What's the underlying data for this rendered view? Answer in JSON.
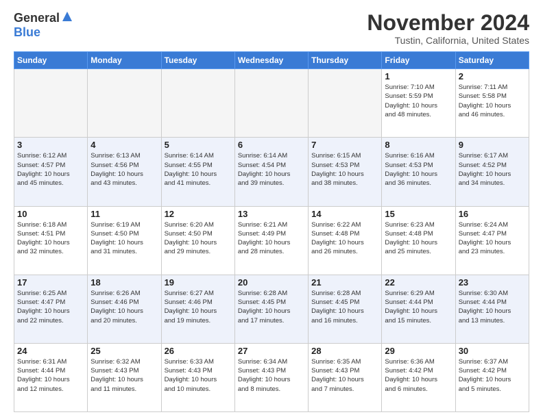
{
  "logo": {
    "general": "General",
    "blue": "Blue"
  },
  "title": "November 2024",
  "location": "Tustin, California, United States",
  "days_of_week": [
    "Sunday",
    "Monday",
    "Tuesday",
    "Wednesday",
    "Thursday",
    "Friday",
    "Saturday"
  ],
  "weeks": [
    [
      {
        "day": "",
        "info": ""
      },
      {
        "day": "",
        "info": ""
      },
      {
        "day": "",
        "info": ""
      },
      {
        "day": "",
        "info": ""
      },
      {
        "day": "",
        "info": ""
      },
      {
        "day": "1",
        "info": "Sunrise: 7:10 AM\nSunset: 5:59 PM\nDaylight: 10 hours\nand 48 minutes."
      },
      {
        "day": "2",
        "info": "Sunrise: 7:11 AM\nSunset: 5:58 PM\nDaylight: 10 hours\nand 46 minutes."
      }
    ],
    [
      {
        "day": "3",
        "info": "Sunrise: 6:12 AM\nSunset: 4:57 PM\nDaylight: 10 hours\nand 45 minutes."
      },
      {
        "day": "4",
        "info": "Sunrise: 6:13 AM\nSunset: 4:56 PM\nDaylight: 10 hours\nand 43 minutes."
      },
      {
        "day": "5",
        "info": "Sunrise: 6:14 AM\nSunset: 4:55 PM\nDaylight: 10 hours\nand 41 minutes."
      },
      {
        "day": "6",
        "info": "Sunrise: 6:14 AM\nSunset: 4:54 PM\nDaylight: 10 hours\nand 39 minutes."
      },
      {
        "day": "7",
        "info": "Sunrise: 6:15 AM\nSunset: 4:53 PM\nDaylight: 10 hours\nand 38 minutes."
      },
      {
        "day": "8",
        "info": "Sunrise: 6:16 AM\nSunset: 4:53 PM\nDaylight: 10 hours\nand 36 minutes."
      },
      {
        "day": "9",
        "info": "Sunrise: 6:17 AM\nSunset: 4:52 PM\nDaylight: 10 hours\nand 34 minutes."
      }
    ],
    [
      {
        "day": "10",
        "info": "Sunrise: 6:18 AM\nSunset: 4:51 PM\nDaylight: 10 hours\nand 32 minutes."
      },
      {
        "day": "11",
        "info": "Sunrise: 6:19 AM\nSunset: 4:50 PM\nDaylight: 10 hours\nand 31 minutes."
      },
      {
        "day": "12",
        "info": "Sunrise: 6:20 AM\nSunset: 4:50 PM\nDaylight: 10 hours\nand 29 minutes."
      },
      {
        "day": "13",
        "info": "Sunrise: 6:21 AM\nSunset: 4:49 PM\nDaylight: 10 hours\nand 28 minutes."
      },
      {
        "day": "14",
        "info": "Sunrise: 6:22 AM\nSunset: 4:48 PM\nDaylight: 10 hours\nand 26 minutes."
      },
      {
        "day": "15",
        "info": "Sunrise: 6:23 AM\nSunset: 4:48 PM\nDaylight: 10 hours\nand 25 minutes."
      },
      {
        "day": "16",
        "info": "Sunrise: 6:24 AM\nSunset: 4:47 PM\nDaylight: 10 hours\nand 23 minutes."
      }
    ],
    [
      {
        "day": "17",
        "info": "Sunrise: 6:25 AM\nSunset: 4:47 PM\nDaylight: 10 hours\nand 22 minutes."
      },
      {
        "day": "18",
        "info": "Sunrise: 6:26 AM\nSunset: 4:46 PM\nDaylight: 10 hours\nand 20 minutes."
      },
      {
        "day": "19",
        "info": "Sunrise: 6:27 AM\nSunset: 4:46 PM\nDaylight: 10 hours\nand 19 minutes."
      },
      {
        "day": "20",
        "info": "Sunrise: 6:28 AM\nSunset: 4:45 PM\nDaylight: 10 hours\nand 17 minutes."
      },
      {
        "day": "21",
        "info": "Sunrise: 6:28 AM\nSunset: 4:45 PM\nDaylight: 10 hours\nand 16 minutes."
      },
      {
        "day": "22",
        "info": "Sunrise: 6:29 AM\nSunset: 4:44 PM\nDaylight: 10 hours\nand 15 minutes."
      },
      {
        "day": "23",
        "info": "Sunrise: 6:30 AM\nSunset: 4:44 PM\nDaylight: 10 hours\nand 13 minutes."
      }
    ],
    [
      {
        "day": "24",
        "info": "Sunrise: 6:31 AM\nSunset: 4:44 PM\nDaylight: 10 hours\nand 12 minutes."
      },
      {
        "day": "25",
        "info": "Sunrise: 6:32 AM\nSunset: 4:43 PM\nDaylight: 10 hours\nand 11 minutes."
      },
      {
        "day": "26",
        "info": "Sunrise: 6:33 AM\nSunset: 4:43 PM\nDaylight: 10 hours\nand 10 minutes."
      },
      {
        "day": "27",
        "info": "Sunrise: 6:34 AM\nSunset: 4:43 PM\nDaylight: 10 hours\nand 8 minutes."
      },
      {
        "day": "28",
        "info": "Sunrise: 6:35 AM\nSunset: 4:43 PM\nDaylight: 10 hours\nand 7 minutes."
      },
      {
        "day": "29",
        "info": "Sunrise: 6:36 AM\nSunset: 4:42 PM\nDaylight: 10 hours\nand 6 minutes."
      },
      {
        "day": "30",
        "info": "Sunrise: 6:37 AM\nSunset: 4:42 PM\nDaylight: 10 hours\nand 5 minutes."
      }
    ]
  ]
}
